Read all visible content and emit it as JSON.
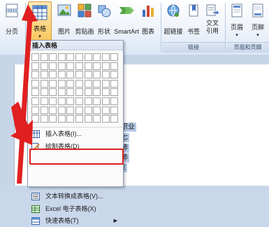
{
  "ribbon": {
    "buttons": {
      "page_break": "分页",
      "table": "表格",
      "picture": "图片",
      "clip_art": "剪贴画",
      "shapes": "形状",
      "smartart": "SmartArt",
      "chart": "图表",
      "hyperlink": "超链接",
      "bookmark": "书签",
      "cross_ref": "交叉\n引用",
      "header": "页眉",
      "footer": "页脚"
    },
    "groups": {
      "links": "链接",
      "header_footer": "页眉和页脚"
    }
  },
  "table_menu": {
    "header": "插入表格",
    "grid": {
      "rows": 8,
      "cols": 10
    },
    "items": [
      {
        "label": "插入表格(I)...",
        "icon": "insert-table-icon"
      },
      {
        "label": "绘制表格(D)",
        "icon": "draw-table-icon"
      },
      {
        "label": "文本转换成表格(V)...",
        "icon": "convert-text-to-table-icon"
      },
      {
        "label": "Excel 电子表格(X)",
        "icon": "excel-spreadsheet-icon"
      },
      {
        "label": "快速表格(T)",
        "icon": "quick-tables-icon"
      }
    ]
  },
  "document": {
    "text_fragments": [
      "职业",
      "七",
      "师",
      "师",
      "E"
    ]
  },
  "colors": {
    "highlight": "#e02020",
    "annotation_arrow": "#e02020",
    "selection": "#b6cbe8"
  }
}
